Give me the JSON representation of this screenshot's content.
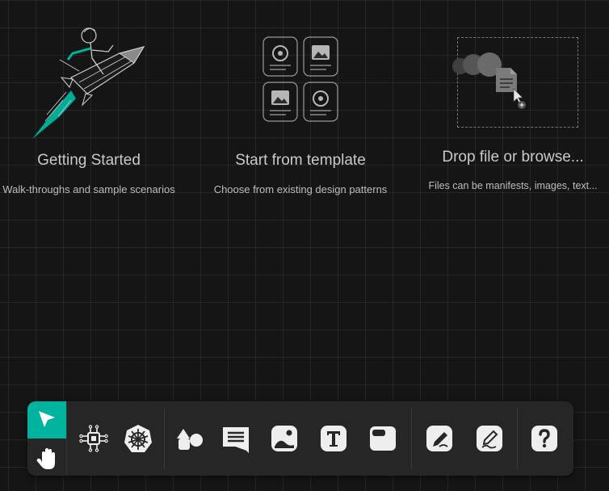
{
  "cards": {
    "getting_started": {
      "title": "Getting Started",
      "subtitle": "Walk-throughs and sample scenarios"
    },
    "template": {
      "title": "Start from template",
      "subtitle": "Choose from existing design patterns"
    },
    "drop": {
      "title": "Drop file or browse...",
      "subtitle": "Files can be manifests, images, text..."
    }
  },
  "toolbar": {
    "tools": [
      {
        "name": "select",
        "icon": "cursor-arrow-icon",
        "active": true
      },
      {
        "name": "pan",
        "icon": "hand-icon"
      },
      {
        "name": "components",
        "icon": "component-chip-icon"
      },
      {
        "name": "kubernetes",
        "icon": "kubernetes-wheel-icon"
      },
      {
        "name": "shapes",
        "icon": "shapes-icon"
      },
      {
        "name": "comment",
        "icon": "comment-icon"
      },
      {
        "name": "image",
        "icon": "image-icon"
      },
      {
        "name": "text",
        "icon": "text-t-icon"
      },
      {
        "name": "section",
        "icon": "section-frame-icon"
      },
      {
        "name": "pen",
        "icon": "pen-icon"
      },
      {
        "name": "pencil",
        "icon": "pencil-icon"
      },
      {
        "name": "help",
        "icon": "question-mark-icon"
      }
    ]
  },
  "colors": {
    "accent": "#00b39f",
    "background": "#151515",
    "toolbar": "#262626",
    "icon": "#eeeeee"
  }
}
